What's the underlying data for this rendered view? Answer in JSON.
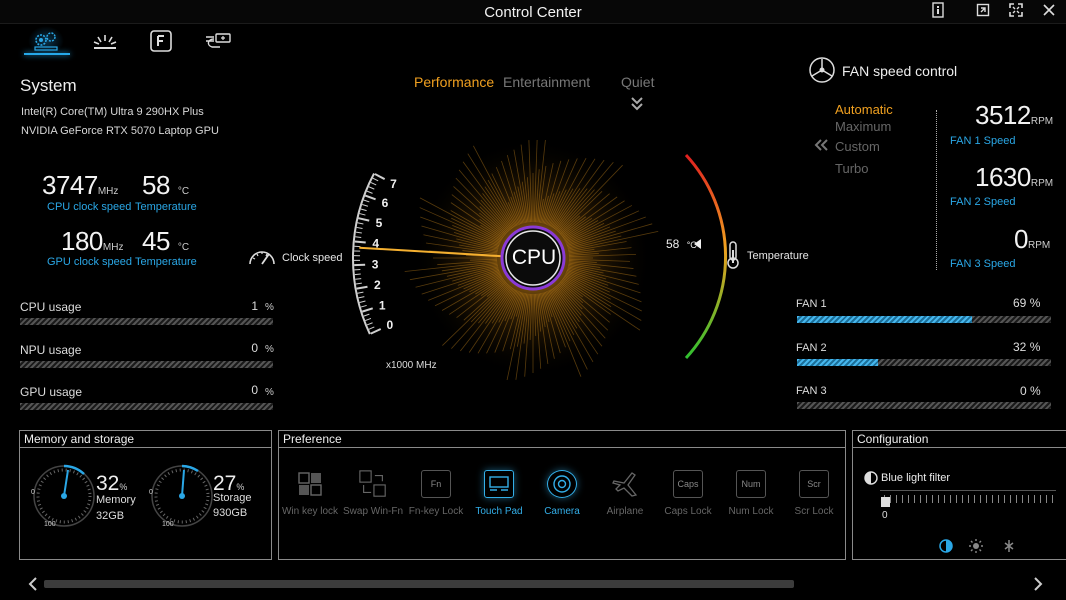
{
  "window": {
    "title": "Control Center"
  },
  "system": {
    "title": "System",
    "cpu_name": "Intel(R) Core(TM) Ultra 9 290HX Plus",
    "gpu_name": "NVIDIA GeForce RTX 5070 Laptop GPU",
    "cpu_clock": "3747",
    "cpu_clock_unit": "MHz",
    "cpu_clock_label": "CPU clock speed",
    "cpu_temp": "58",
    "cpu_temp_unit": "°C",
    "cpu_temp_label": "Temperature",
    "gpu_clock": "180",
    "gpu_clock_unit": "MHz",
    "gpu_clock_label": "GPU clock speed",
    "gpu_temp": "45",
    "gpu_temp_unit": "°C",
    "gpu_temp_label": "Temperature"
  },
  "usage": [
    {
      "label": "CPU usage",
      "value": "1",
      "unit": "%"
    },
    {
      "label": "NPU usage",
      "value": "0",
      "unit": "%"
    },
    {
      "label": "GPU usage",
      "value": "0",
      "unit": "%"
    }
  ],
  "modes": {
    "performance": "Performance",
    "entertainment": "Entertainment",
    "quiet": "Quiet",
    "active": "Performance"
  },
  "gauge": {
    "center_label": "CPU",
    "clock_label": "Clock speed",
    "temp_label": "Temperature",
    "temp_value": "58",
    "temp_unit": "°C",
    "scale_unit": "x1000 MHz",
    "ticks": [
      "0",
      "1",
      "2",
      "3",
      "4",
      "5",
      "6",
      "7"
    ],
    "clock_value_ghz": 3.747
  },
  "fan": {
    "title": "FAN speed control",
    "modes": [
      "Automatic",
      "Maximum",
      "Custom",
      "Turbo"
    ],
    "active_mode": "Automatic",
    "speeds": [
      {
        "value": "3512",
        "unit": "RPM",
        "label": "FAN 1 Speed"
      },
      {
        "value": "1630",
        "unit": "RPM",
        "label": "FAN 2 Speed"
      },
      {
        "value": "0",
        "unit": "RPM",
        "label": "FAN 3 Speed"
      }
    ],
    "bars": [
      {
        "label": "FAN 1",
        "value": "69",
        "unit": "%",
        "level": 0.69
      },
      {
        "label": "FAN 2",
        "value": "32",
        "unit": "%",
        "level": 0.32
      },
      {
        "label": "FAN 3",
        "value": "0",
        "unit": "%",
        "level": 0
      }
    ]
  },
  "memory": {
    "title": "Memory and storage",
    "mem_percent": "32",
    "mem_percent_unit": "%",
    "mem_label": "Memory",
    "mem_size": "32GB",
    "sto_percent": "27",
    "sto_percent_unit": "%",
    "sto_label": "Storage",
    "sto_size": "930GB",
    "dial_min": "0",
    "dial_max": "100"
  },
  "preference": {
    "title": "Preference",
    "items": [
      {
        "label": "Win key lock",
        "icon": "windows-grid-icon",
        "on": false
      },
      {
        "label": "Swap Win-Fn",
        "icon": "swap-icon",
        "on": false
      },
      {
        "label": "Fn-key Lock",
        "icon": "fn-key-icon",
        "key": "Fn",
        "on": false
      },
      {
        "label": "Touch Pad",
        "icon": "touchpad-icon",
        "on": true
      },
      {
        "label": "Camera",
        "icon": "camera-icon",
        "on": true
      },
      {
        "label": "Airplane",
        "icon": "airplane-icon",
        "on": false
      },
      {
        "label": "Caps Lock",
        "icon": "caps-key-icon",
        "key": "Caps",
        "on": false
      },
      {
        "label": "Num Lock",
        "icon": "num-key-icon",
        "key": "Num",
        "on": false
      },
      {
        "label": "Scr Lock",
        "icon": "scr-key-icon",
        "key": "Scr",
        "on": false
      }
    ]
  },
  "configuration": {
    "title": "Configuration",
    "blue_light_label": "Blue light filter",
    "blue_light_value": "0"
  },
  "colors": {
    "accent": "#2aa7e6",
    "active_mode": "#f0a020",
    "gauge_warm": "#f5a623"
  }
}
